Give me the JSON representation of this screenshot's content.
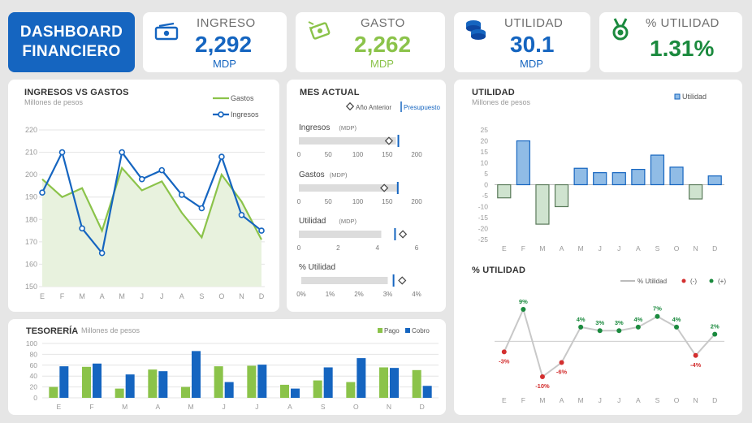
{
  "header": {
    "title_line1": "DASHBOARD",
    "title_line2": "FINANCIERO"
  },
  "kpis": {
    "ingreso": {
      "label": "INGRESO",
      "value": "2,292",
      "unit": "MDP",
      "color": "#1565c0",
      "icon": "money-icon"
    },
    "gasto": {
      "label": "GASTO",
      "value": "2,262",
      "unit": "MDP",
      "color": "#8bc34a",
      "icon": "flying-money-icon"
    },
    "utilidad": {
      "label": "UTILIDAD",
      "value": "30.1",
      "unit": "MDP",
      "color": "#1565c0",
      "icon": "coins-icon"
    },
    "pct_utilidad": {
      "label": "% UTILIDAD",
      "value": "1.31%",
      "unit": "",
      "color": "#1b8a3e",
      "icon": "medal-icon"
    }
  },
  "colors": {
    "blue": "#1565c0",
    "green": "#8bc34a",
    "dark_green": "#1b8a3e",
    "red": "#d32f2f",
    "bar_fill": "#90bce6",
    "bar_neg_fill": "#cfe3cf"
  },
  "months": [
    "E",
    "F",
    "M",
    "A",
    "M",
    "J",
    "J",
    "A",
    "S",
    "O",
    "N",
    "D"
  ],
  "chart_data": [
    {
      "id": "ingresos_vs_gastos",
      "type": "line",
      "title": "INGRESOS VS GASTOS",
      "subtitle": "Millones de pesos",
      "categories": [
        "E",
        "F",
        "M",
        "A",
        "M",
        "J",
        "J",
        "A",
        "S",
        "O",
        "N",
        "D"
      ],
      "series": [
        {
          "name": "Gastos",
          "values": [
            198,
            190,
            194,
            175,
            203,
            193,
            197,
            183,
            172,
            200,
            188,
            171
          ],
          "color": "#8bc34a"
        },
        {
          "name": "Ingresos",
          "values": [
            192,
            210,
            176,
            165,
            210,
            198,
            202,
            191,
            185,
            208,
            182,
            175
          ],
          "color": "#1565c0"
        }
      ],
      "ylim": [
        150,
        220
      ],
      "yticks": [
        "150",
        "160",
        "170",
        "180",
        "190",
        "200",
        "210",
        "220"
      ],
      "grid": true,
      "legend": "top-right"
    },
    {
      "id": "mes_actual",
      "type": "bar",
      "title": "MES ACTUAL",
      "legend_labels": [
        "Año Anterior",
        "Presupuesto"
      ],
      "bullets": [
        {
          "label": "Ingresos",
          "unit": "(MDP)",
          "actual": 165,
          "anterior": 153,
          "presupuesto": 169,
          "max": 200,
          "ticks": [
            "0",
            "50",
            "100",
            "150",
            "200"
          ]
        },
        {
          "label": "Gastos",
          "unit": "(MDP)",
          "actual": 167,
          "anterior": 145,
          "presupuesto": 168,
          "max": 200,
          "ticks": [
            "0",
            "50",
            "100",
            "150",
            "200"
          ]
        },
        {
          "label": "Utilidad",
          "unit": "(MDP)",
          "actual": 4.2,
          "anterior": 5.3,
          "presupuesto": 4.9,
          "max": 6,
          "ticks": [
            "0",
            "2",
            "4",
            "6"
          ]
        },
        {
          "label": "% Utilidad",
          "unit": "",
          "actual": 3.0,
          "anterior": 3.5,
          "presupuesto": 3.2,
          "max": 4,
          "ticks": [
            "0%",
            "1%",
            "2%",
            "3%",
            "4%"
          ]
        }
      ]
    },
    {
      "id": "utilidad",
      "type": "bar",
      "title": "UTILIDAD",
      "subtitle": "Millones de pesos",
      "legend": "Utilidad",
      "categories": [
        "E",
        "F",
        "M",
        "A",
        "M",
        "J",
        "J",
        "A",
        "S",
        "O",
        "N",
        "D"
      ],
      "values": [
        -6,
        20,
        -18,
        -10,
        7.5,
        5.5,
        5.5,
        7,
        13.5,
        8,
        -6.5,
        4
      ],
      "ylim": [
        -25,
        25
      ],
      "yticks": [
        "25",
        "20",
        "15",
        "10",
        "5",
        "0",
        "-5",
        "-10",
        "-15",
        "-20",
        "-25"
      ]
    },
    {
      "id": "pct_utilidad",
      "type": "line",
      "title": "% UTILIDAD",
      "legend_labels": [
        "% Utilidad",
        "(-)",
        "(+)"
      ],
      "categories": [
        "E",
        "F",
        "M",
        "A",
        "M",
        "J",
        "J",
        "A",
        "S",
        "O",
        "N",
        "D"
      ],
      "values": [
        -3,
        9,
        -10,
        -6,
        4,
        3,
        3,
        4,
        7,
        4,
        -4,
        2
      ],
      "labels": [
        "-3%",
        "9%",
        "-10%",
        "-6%",
        "4%",
        "3%",
        "3%",
        "4%",
        "7%",
        "4%",
        "-4%",
        "2%"
      ]
    },
    {
      "id": "tesoreria",
      "type": "bar",
      "title": "TESORERÍA",
      "subtitle": "Millones de pesos",
      "categories": [
        "E",
        "F",
        "M",
        "A",
        "M",
        "J",
        "J",
        "A",
        "S",
        "O",
        "N",
        "D"
      ],
      "series": [
        {
          "name": "Pago",
          "values": [
            20,
            57,
            17,
            52,
            20,
            58,
            59,
            24,
            32,
            29,
            56,
            51
          ],
          "color": "#8bc34a"
        },
        {
          "name": "Cobro",
          "values": [
            58,
            63,
            43,
            49,
            86,
            29,
            61,
            17,
            56,
            73,
            55,
            22
          ],
          "color": "#1565c0"
        }
      ],
      "ylim": [
        0,
        100
      ],
      "yticks": [
        "0",
        "20",
        "40",
        "60",
        "80",
        "100"
      ]
    }
  ]
}
